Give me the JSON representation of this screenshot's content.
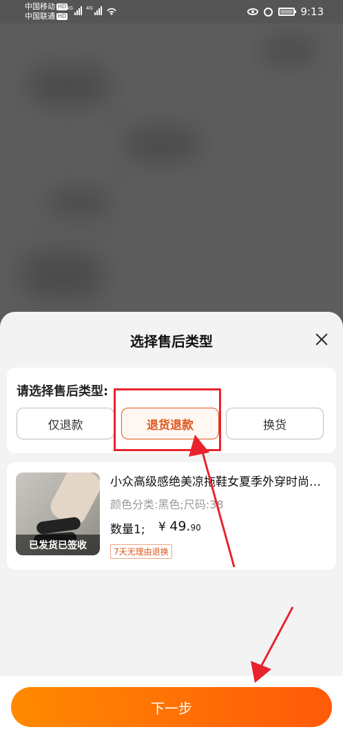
{
  "status_bar": {
    "carrier1": "中国移动",
    "carrier2": "中国联通",
    "hd": "HD",
    "net1": "4G",
    "net2": "4G",
    "time": "9:13"
  },
  "sheet": {
    "title": "选择售后类型",
    "type_label": "请选择售后类型:",
    "types": [
      "仅退款",
      "退货退款",
      "换货"
    ],
    "selected_type": "退货退款"
  },
  "product": {
    "name": "小众高级感绝美凉拖鞋女夏季外穿时尚百搭",
    "spec": "颜色分类:黑色;尺码:38",
    "qty": "数量1;",
    "price_symbol": "¥",
    "price_int": "49.",
    "price_dec": "90",
    "tag": "7天无理由退换",
    "badge": "已发货已签收"
  },
  "bottom": {
    "next_label": "下一步"
  },
  "colors": {
    "accent": "#e0561b",
    "button_start": "#ff8a00",
    "button_end": "#ff5a0a",
    "annotation": "#e8232b"
  }
}
